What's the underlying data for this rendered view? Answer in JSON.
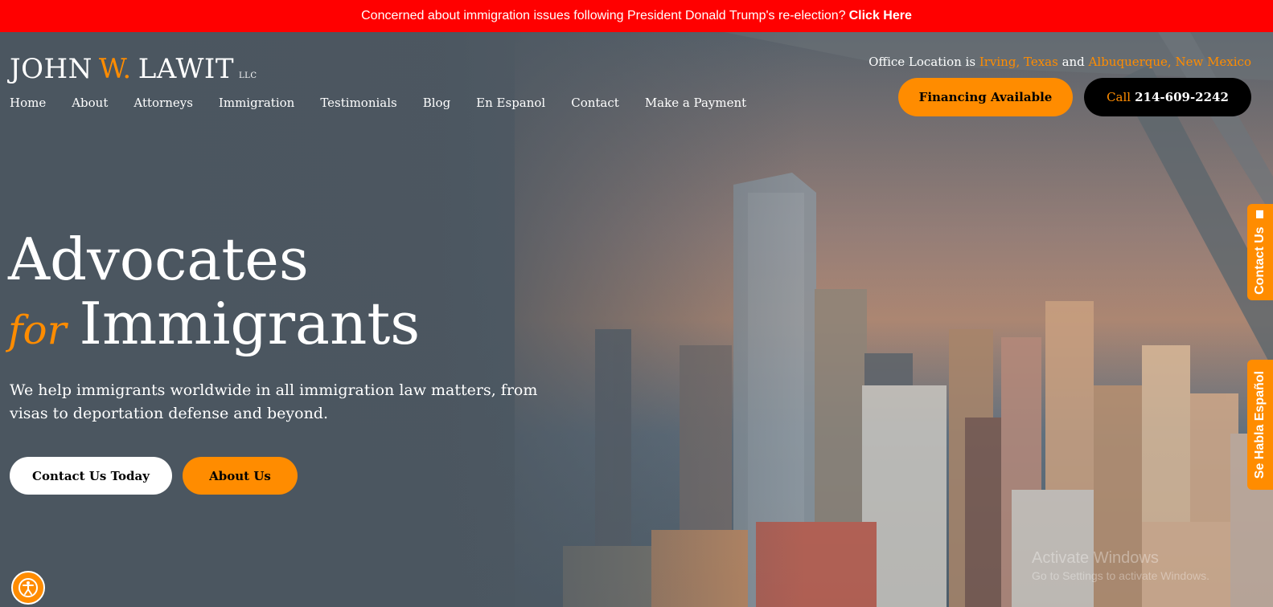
{
  "announcement": {
    "text": "Concerned about immigration issues following President Donald Trump's re-election?",
    "cta": "Click Here"
  },
  "brand": {
    "name_first": "JOHN",
    "name_middle": "W.",
    "name_last": "LAWIT",
    "suffix": "LLC",
    "accent_color": "#ff8c00"
  },
  "nav": {
    "items": [
      "Home",
      "About",
      "Attorneys",
      "Immigration",
      "Testimonials",
      "Blog",
      "En Espanol",
      "Contact",
      "Make a Payment"
    ]
  },
  "office": {
    "prefix": "Office Location is",
    "location1": "Irving, Texas",
    "and": "and",
    "location2": "Albuquerque, New Mexico"
  },
  "header_buttons": {
    "financing": "Financing Available",
    "call_label": "Call",
    "call_number": "214-609-2242"
  },
  "hero": {
    "title_line1": "Advocates",
    "title_for": "for",
    "title_line2": "Immigrants",
    "lead": "We help immigrants worldwide in all immigration law matters, from visas to deportation defense and beyond.",
    "contact_button": "Contact Us Today",
    "about_button": "About Us"
  },
  "side_tabs": {
    "contact": "Contact Us",
    "espanol": "Se Habla Español"
  },
  "watermark": {
    "line1": "Activate Windows",
    "line2": "Go to Settings to activate Windows."
  },
  "colors": {
    "announcement_bg": "#ff0000",
    "accent": "#ff8c00",
    "call_button_bg": "#000000"
  }
}
